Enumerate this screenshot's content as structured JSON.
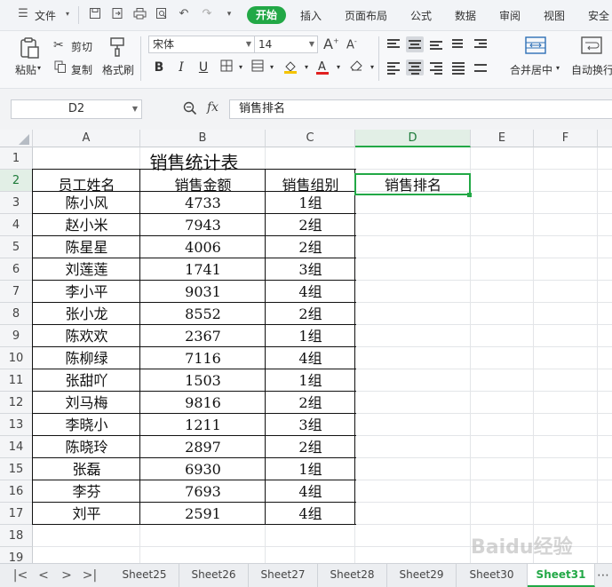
{
  "menubar": {
    "file": "文件",
    "tabs": [
      "开始",
      "插入",
      "页面布局",
      "公式",
      "数据",
      "审阅",
      "视图",
      "安全"
    ]
  },
  "ribbon": {
    "paste": "粘贴",
    "cut": "剪切",
    "copy": "复制",
    "format_painter": "格式刷",
    "font_name": "宋体",
    "font_size": "14",
    "merge_center": "合并居中",
    "auto_wrap": "自动换行"
  },
  "formula_bar": {
    "name_box": "D2",
    "fx": "fx",
    "content": "销售排名"
  },
  "grid": {
    "columns": [
      "A",
      "B",
      "C",
      "D",
      "E",
      "F"
    ],
    "rows": [
      "1",
      "2",
      "3",
      "4",
      "5",
      "6",
      "7",
      "8",
      "9",
      "10",
      "11",
      "12",
      "13",
      "14",
      "15",
      "16",
      "17",
      "18",
      "19"
    ],
    "title": "销售统计表",
    "headers": [
      "员工姓名",
      "销售金额",
      "销售组别",
      "销售排名"
    ],
    "records": [
      {
        "name": "陈小风",
        "amount": "4733",
        "group": "1组"
      },
      {
        "name": "赵小米",
        "amount": "7943",
        "group": "2组"
      },
      {
        "name": "陈星星",
        "amount": "4006",
        "group": "2组"
      },
      {
        "name": "刘莲莲",
        "amount": "1741",
        "group": "3组"
      },
      {
        "name": "李小平",
        "amount": "9031",
        "group": "4组"
      },
      {
        "name": "张小龙",
        "amount": "8552",
        "group": "2组"
      },
      {
        "name": "陈欢欢",
        "amount": "2367",
        "group": "1组"
      },
      {
        "name": "陈柳绿",
        "amount": "7116",
        "group": "4组"
      },
      {
        "name": "张甜吖",
        "amount": "1503",
        "group": "1组"
      },
      {
        "name": "刘马梅",
        "amount": "9816",
        "group": "2组"
      },
      {
        "name": "李晓小",
        "amount": "1211",
        "group": "3组"
      },
      {
        "name": "陈晓玲",
        "amount": "2897",
        "group": "2组"
      },
      {
        "name": "张磊",
        "amount": "6930",
        "group": "1组"
      },
      {
        "name": "李芬",
        "amount": "7693",
        "group": "4组"
      },
      {
        "name": "刘平",
        "amount": "2591",
        "group": "4组"
      }
    ]
  },
  "sheet_tabs": {
    "tabs": [
      "Sheet25",
      "Sheet26",
      "Sheet27",
      "Sheet28",
      "Sheet29",
      "Sheet30",
      "Sheet31"
    ],
    "active": "Sheet31"
  },
  "watermark": "Baidu经验",
  "colors": {
    "accent": "#22a846",
    "selection": "#22a846"
  }
}
